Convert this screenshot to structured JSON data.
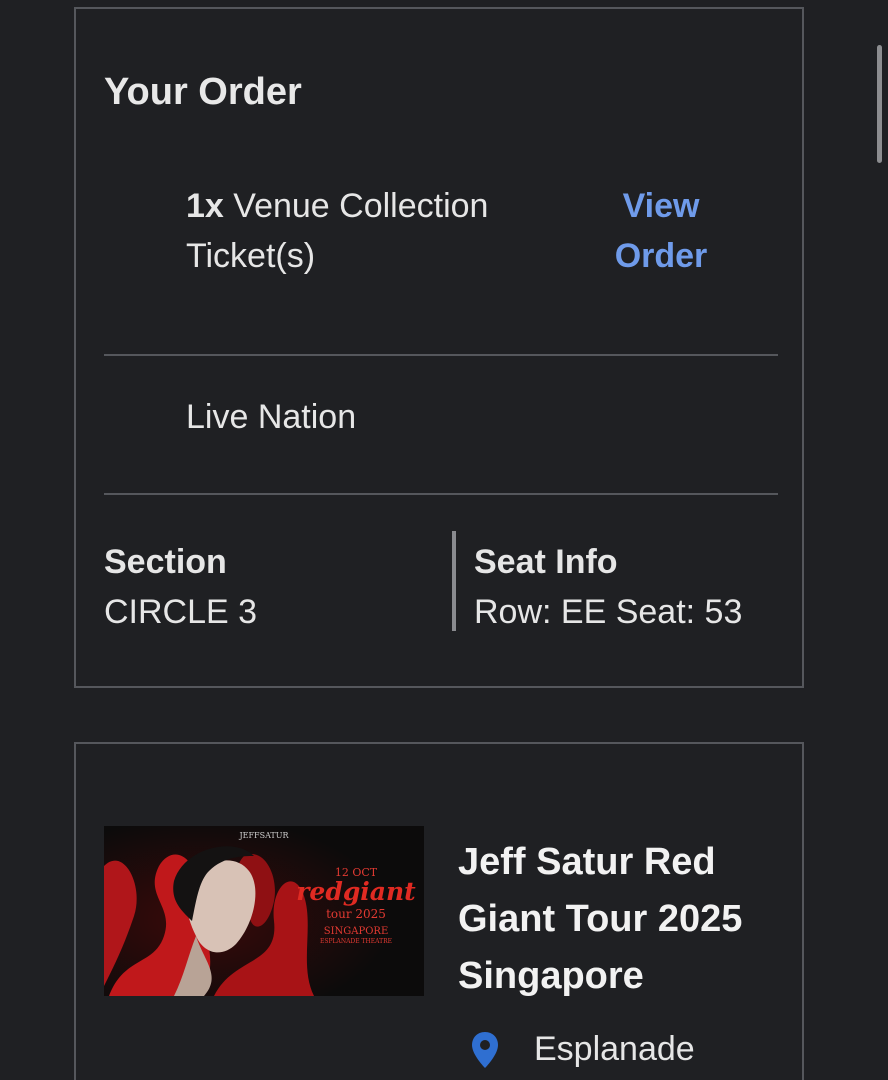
{
  "order": {
    "title": "Your Order",
    "quantity": "1x",
    "ticket_type": "Venue Collection Ticket(s)",
    "view_order_label": "View Order",
    "organizer": "Live Nation",
    "section_label": "Section",
    "section_value": "CIRCLE 3",
    "seat_label": "Seat Info",
    "seat_value": "Row: EE Seat: 53"
  },
  "event": {
    "title": "Jeff Satur Red Giant Tour 2025 Singapore",
    "venue": "Esplanade",
    "poster": {
      "brand": "JEFFSATUR",
      "date": "12 OCT",
      "headline": "redgiant",
      "tour": "tour 2025",
      "city": "SINGAPORE",
      "venue": "ESPLANADE THEATRE"
    }
  },
  "colors": {
    "background": "#1f2023",
    "border": "#55575c",
    "link": "#6f9bea",
    "pin": "#2f6fd1",
    "poster_red": "#c0181b"
  },
  "icons": {
    "location": "map-pin-icon"
  }
}
